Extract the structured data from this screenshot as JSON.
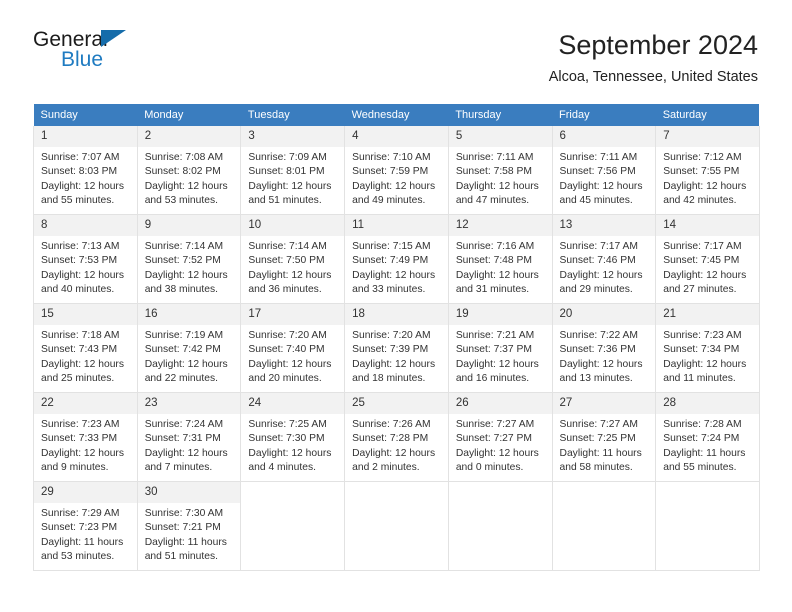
{
  "brand": {
    "name_part1": "General",
    "name_part2": "Blue",
    "logo_icon": "triangle-icon",
    "accent_color": "#1f7bc1",
    "header_color": "#3a7dbf"
  },
  "header": {
    "title": "September 2024",
    "subtitle": "Alcoa, Tennessee, United States"
  },
  "calendar": {
    "weekday_headers": [
      "Sunday",
      "Monday",
      "Tuesday",
      "Wednesday",
      "Thursday",
      "Friday",
      "Saturday"
    ],
    "weeks": [
      [
        {
          "day": "1",
          "sunrise": "Sunrise: 7:07 AM",
          "sunset": "Sunset: 8:03 PM",
          "daylight_line1": "Daylight: 12 hours",
          "daylight_line2": "and 55 minutes."
        },
        {
          "day": "2",
          "sunrise": "Sunrise: 7:08 AM",
          "sunset": "Sunset: 8:02 PM",
          "daylight_line1": "Daylight: 12 hours",
          "daylight_line2": "and 53 minutes."
        },
        {
          "day": "3",
          "sunrise": "Sunrise: 7:09 AM",
          "sunset": "Sunset: 8:01 PM",
          "daylight_line1": "Daylight: 12 hours",
          "daylight_line2": "and 51 minutes."
        },
        {
          "day": "4",
          "sunrise": "Sunrise: 7:10 AM",
          "sunset": "Sunset: 7:59 PM",
          "daylight_line1": "Daylight: 12 hours",
          "daylight_line2": "and 49 minutes."
        },
        {
          "day": "5",
          "sunrise": "Sunrise: 7:11 AM",
          "sunset": "Sunset: 7:58 PM",
          "daylight_line1": "Daylight: 12 hours",
          "daylight_line2": "and 47 minutes."
        },
        {
          "day": "6",
          "sunrise": "Sunrise: 7:11 AM",
          "sunset": "Sunset: 7:56 PM",
          "daylight_line1": "Daylight: 12 hours",
          "daylight_line2": "and 45 minutes."
        },
        {
          "day": "7",
          "sunrise": "Sunrise: 7:12 AM",
          "sunset": "Sunset: 7:55 PM",
          "daylight_line1": "Daylight: 12 hours",
          "daylight_line2": "and 42 minutes."
        }
      ],
      [
        {
          "day": "8",
          "sunrise": "Sunrise: 7:13 AM",
          "sunset": "Sunset: 7:53 PM",
          "daylight_line1": "Daylight: 12 hours",
          "daylight_line2": "and 40 minutes."
        },
        {
          "day": "9",
          "sunrise": "Sunrise: 7:14 AM",
          "sunset": "Sunset: 7:52 PM",
          "daylight_line1": "Daylight: 12 hours",
          "daylight_line2": "and 38 minutes."
        },
        {
          "day": "10",
          "sunrise": "Sunrise: 7:14 AM",
          "sunset": "Sunset: 7:50 PM",
          "daylight_line1": "Daylight: 12 hours",
          "daylight_line2": "and 36 minutes."
        },
        {
          "day": "11",
          "sunrise": "Sunrise: 7:15 AM",
          "sunset": "Sunset: 7:49 PM",
          "daylight_line1": "Daylight: 12 hours",
          "daylight_line2": "and 33 minutes."
        },
        {
          "day": "12",
          "sunrise": "Sunrise: 7:16 AM",
          "sunset": "Sunset: 7:48 PM",
          "daylight_line1": "Daylight: 12 hours",
          "daylight_line2": "and 31 minutes."
        },
        {
          "day": "13",
          "sunrise": "Sunrise: 7:17 AM",
          "sunset": "Sunset: 7:46 PM",
          "daylight_line1": "Daylight: 12 hours",
          "daylight_line2": "and 29 minutes."
        },
        {
          "day": "14",
          "sunrise": "Sunrise: 7:17 AM",
          "sunset": "Sunset: 7:45 PM",
          "daylight_line1": "Daylight: 12 hours",
          "daylight_line2": "and 27 minutes."
        }
      ],
      [
        {
          "day": "15",
          "sunrise": "Sunrise: 7:18 AM",
          "sunset": "Sunset: 7:43 PM",
          "daylight_line1": "Daylight: 12 hours",
          "daylight_line2": "and 25 minutes."
        },
        {
          "day": "16",
          "sunrise": "Sunrise: 7:19 AM",
          "sunset": "Sunset: 7:42 PM",
          "daylight_line1": "Daylight: 12 hours",
          "daylight_line2": "and 22 minutes."
        },
        {
          "day": "17",
          "sunrise": "Sunrise: 7:20 AM",
          "sunset": "Sunset: 7:40 PM",
          "daylight_line1": "Daylight: 12 hours",
          "daylight_line2": "and 20 minutes."
        },
        {
          "day": "18",
          "sunrise": "Sunrise: 7:20 AM",
          "sunset": "Sunset: 7:39 PM",
          "daylight_line1": "Daylight: 12 hours",
          "daylight_line2": "and 18 minutes."
        },
        {
          "day": "19",
          "sunrise": "Sunrise: 7:21 AM",
          "sunset": "Sunset: 7:37 PM",
          "daylight_line1": "Daylight: 12 hours",
          "daylight_line2": "and 16 minutes."
        },
        {
          "day": "20",
          "sunrise": "Sunrise: 7:22 AM",
          "sunset": "Sunset: 7:36 PM",
          "daylight_line1": "Daylight: 12 hours",
          "daylight_line2": "and 13 minutes."
        },
        {
          "day": "21",
          "sunrise": "Sunrise: 7:23 AM",
          "sunset": "Sunset: 7:34 PM",
          "daylight_line1": "Daylight: 12 hours",
          "daylight_line2": "and 11 minutes."
        }
      ],
      [
        {
          "day": "22",
          "sunrise": "Sunrise: 7:23 AM",
          "sunset": "Sunset: 7:33 PM",
          "daylight_line1": "Daylight: 12 hours",
          "daylight_line2": "and 9 minutes."
        },
        {
          "day": "23",
          "sunrise": "Sunrise: 7:24 AM",
          "sunset": "Sunset: 7:31 PM",
          "daylight_line1": "Daylight: 12 hours",
          "daylight_line2": "and 7 minutes."
        },
        {
          "day": "24",
          "sunrise": "Sunrise: 7:25 AM",
          "sunset": "Sunset: 7:30 PM",
          "daylight_line1": "Daylight: 12 hours",
          "daylight_line2": "and 4 minutes."
        },
        {
          "day": "25",
          "sunrise": "Sunrise: 7:26 AM",
          "sunset": "Sunset: 7:28 PM",
          "daylight_line1": "Daylight: 12 hours",
          "daylight_line2": "and 2 minutes."
        },
        {
          "day": "26",
          "sunrise": "Sunrise: 7:27 AM",
          "sunset": "Sunset: 7:27 PM",
          "daylight_line1": "Daylight: 12 hours",
          "daylight_line2": "and 0 minutes."
        },
        {
          "day": "27",
          "sunrise": "Sunrise: 7:27 AM",
          "sunset": "Sunset: 7:25 PM",
          "daylight_line1": "Daylight: 11 hours",
          "daylight_line2": "and 58 minutes."
        },
        {
          "day": "28",
          "sunrise": "Sunrise: 7:28 AM",
          "sunset": "Sunset: 7:24 PM",
          "daylight_line1": "Daylight: 11 hours",
          "daylight_line2": "and 55 minutes."
        }
      ],
      [
        {
          "day": "29",
          "sunrise": "Sunrise: 7:29 AM",
          "sunset": "Sunset: 7:23 PM",
          "daylight_line1": "Daylight: 11 hours",
          "daylight_line2": "and 53 minutes."
        },
        {
          "day": "30",
          "sunrise": "Sunrise: 7:30 AM",
          "sunset": "Sunset: 7:21 PM",
          "daylight_line1": "Daylight: 11 hours",
          "daylight_line2": "and 51 minutes."
        },
        null,
        null,
        null,
        null,
        null
      ]
    ]
  }
}
